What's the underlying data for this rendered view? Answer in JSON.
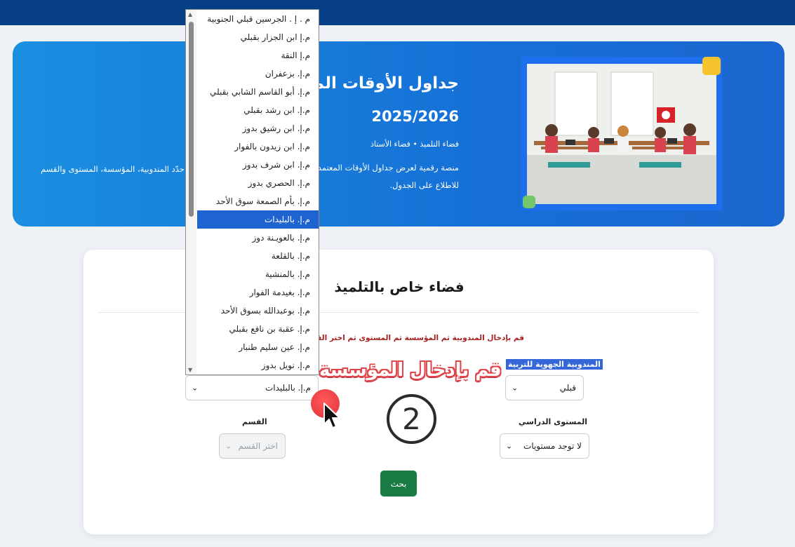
{
  "hero": {
    "title": "جداول الأوقات المدرسية",
    "year": "2025/2026",
    "subtitle": "فضاء التلميذ • فضاء الأستاذ",
    "description_line1": "منصة رقمية لعرض جداول الأوقات المعتمدة",
    "description_line2": "للاطلاع على الجدول.",
    "description_tail": "حدّد المندوبية، المؤسسة، المستوى والقسم"
  },
  "card": {
    "title": "فضاء خاص بالتلميذ",
    "hint": "قم بإدخال المندوبية ثم المؤسسة ثم المستوى ثم اختر القسم ثم اضغط بحث"
  },
  "form": {
    "region_label": "المندوبية الجهوية للتربية",
    "region_value": "قبلي",
    "school_value": "م.إ. بالبليدات",
    "level_label": "المستوى الدراسي",
    "level_value": "لا توجد مستويات",
    "class_label": "القسم",
    "class_placeholder": "اختر القسم",
    "search_label": "بحث"
  },
  "dropdown": {
    "selected_index": 11,
    "options": [
      "م . إ . الجرسين قبلي الجنوبية",
      "م.إ ابن الجزار بقبلي",
      "م.إ النقة",
      "م.إ. بزعفران",
      "م.إ. أبو القاسم الشابي بقبلي",
      "م.إ. ابن رشد بقبلي",
      "م.إ. ابن رشيق بدوز",
      "م.إ. ابن زيدون بالفوار",
      "م.إ. ابن شرف بدوز",
      "م.إ. الحصري بدوز",
      "م.إ. بأم الصمعة سوق الأحد",
      "م.إ. بالبليدات",
      "م.إ. بالعويـنة دوز",
      "م.إ. بالقلعة",
      "م.إ. بالمنشية",
      "م.إ. بغيدمة الفوار",
      "م.إ. بوعبدالله بسوق الأحد",
      "م.إ. عقبة بن نافع بقبلي",
      "م.إ. عين سليم طنبار",
      "م.إ. نويل بدوز"
    ]
  },
  "annotation": {
    "text": "قم بإدخال المؤسسة",
    "step": "2"
  },
  "icons": {
    "select_arrow": "chevron-down-icon",
    "cursor": "mouse-pointer-icon"
  },
  "colors": {
    "topbar": "#063f85",
    "hero": "#1670d6",
    "hint": "#a62020",
    "search_button": "#1a7a44",
    "selected_option": "#1f63d1",
    "annotation": "#e0454b"
  }
}
